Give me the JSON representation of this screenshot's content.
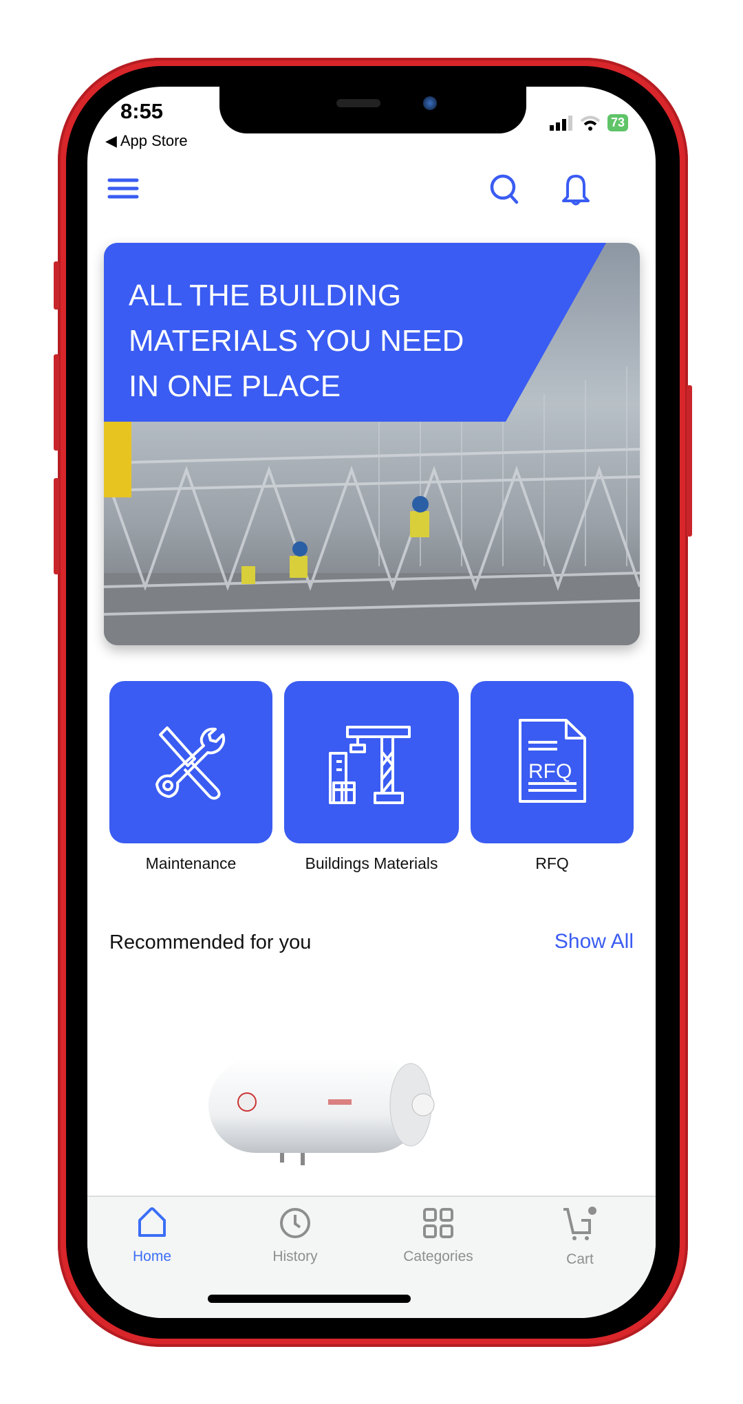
{
  "status_bar": {
    "time": "8:55",
    "back_label": "◀ App Store",
    "battery": "73"
  },
  "header": {
    "menu_icon": "hamburger-icon",
    "search_icon": "search-icon",
    "notification_icon": "bell-icon"
  },
  "banner": {
    "lines": [
      "ALL THE BUILDING",
      "MATERIALS YOU NEED",
      "IN ONE PLACE"
    ]
  },
  "categories": [
    {
      "label": "Maintenance",
      "icon": "tools-icon"
    },
    {
      "label": "Buildings Materials",
      "icon": "crane-icon"
    },
    {
      "label": "RFQ",
      "icon": "rfq-document-icon",
      "icon_text": "RFQ"
    }
  ],
  "recommended": {
    "title": "Recommended for you",
    "show_all": "Show All"
  },
  "tabs": [
    {
      "label": "Home",
      "active": true
    },
    {
      "label": "History"
    },
    {
      "label": "Categories"
    },
    {
      "label": "Cart"
    }
  ],
  "colors": {
    "accent": "#3a5cf2",
    "frame": "#d8262b",
    "inactive": "#8e8e8e"
  }
}
